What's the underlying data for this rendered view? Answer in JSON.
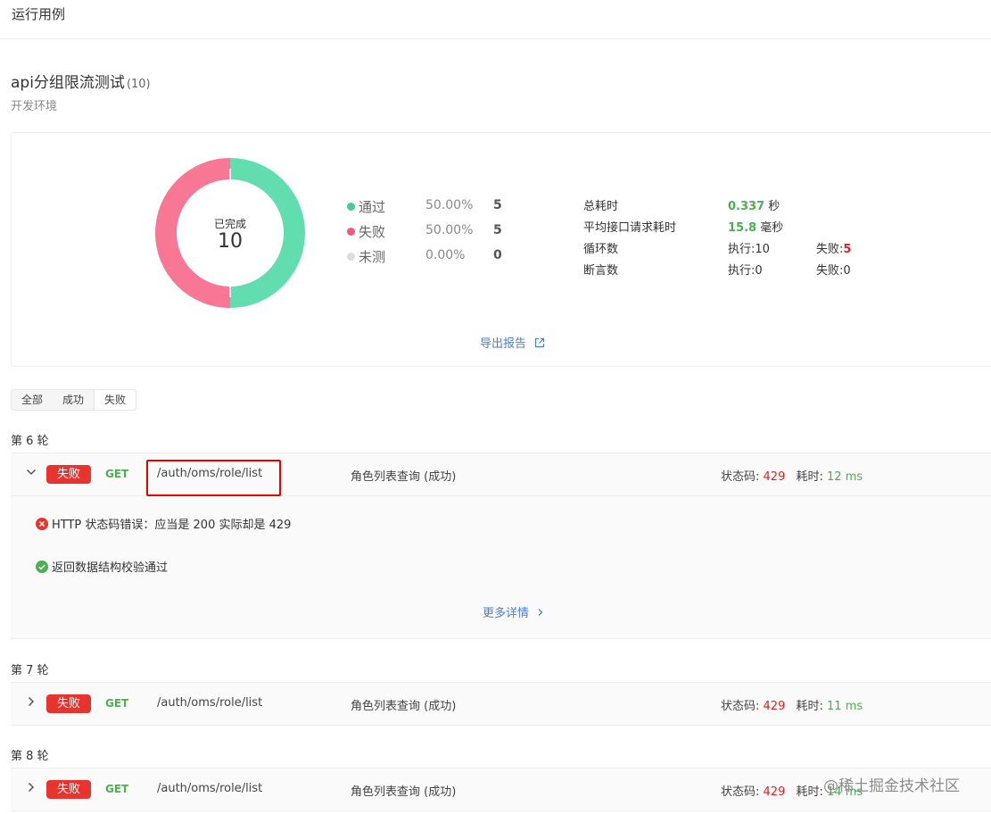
{
  "header": {
    "title": "运行用例"
  },
  "suite": {
    "name": "api分组限流测试",
    "count": "(10)",
    "env": "开发环境"
  },
  "summary": {
    "donut": {
      "label": "已完成",
      "value": "10",
      "pass_fraction": 0.5,
      "fail_fraction": 0.5,
      "pass_color": "#62ddb0",
      "fail_color": "#f87795"
    },
    "legend": [
      {
        "name": "通过",
        "pct": "50.00%",
        "count": "5",
        "color": "#3fcf8f"
      },
      {
        "name": "失败",
        "pct": "50.00%",
        "count": "5",
        "color": "#f5587f"
      },
      {
        "name": "未测",
        "pct": "0.00%",
        "count": "0",
        "color": "#dddddd"
      }
    ],
    "stats": {
      "total_time_label": "总耗时",
      "total_time_value": "0.337",
      "total_time_unit": "秒",
      "avg_time_label": "平均接口请求耗时",
      "avg_time_value": "15.8",
      "avg_time_unit": "毫秒",
      "loop_label": "循环数",
      "loop_exec": "执行:10",
      "loop_fail_label": "失败:",
      "loop_fail_value": "5",
      "assert_label": "断言数",
      "assert_exec": "执行:0",
      "assert_fail": "失败:0"
    },
    "export_label": "导出报告"
  },
  "filters": [
    {
      "label": "全部"
    },
    {
      "label": "成功"
    },
    {
      "label": "失败",
      "active": true
    }
  ],
  "rounds": [
    {
      "label": "第 6 轮",
      "expanded": true,
      "status": "失败",
      "method": "GET",
      "path": "/auth/oms/role/list",
      "case": "角色列表查询 (成功)",
      "status_code_label": "状态码:",
      "status_code": "429",
      "time_label": "耗时:",
      "time": "12 ms",
      "assertions": [
        {
          "type": "error",
          "text": "HTTP 状态码错误：应当是 200 实际却是 429"
        },
        {
          "type": "success",
          "text": "返回数据结构校验通过"
        }
      ],
      "more_label": "更多详情"
    },
    {
      "label": "第 7 轮",
      "expanded": false,
      "status": "失败",
      "method": "GET",
      "path": "/auth/oms/role/list",
      "case": "角色列表查询 (成功)",
      "status_code_label": "状态码:",
      "status_code": "429",
      "time_label": "耗时:",
      "time": "11 ms"
    },
    {
      "label": "第 8 轮",
      "expanded": false,
      "status": "失败",
      "method": "GET",
      "path": "/auth/oms/role/list",
      "case": "角色列表查询 (成功)",
      "status_code_label": "状态码:",
      "status_code": "429",
      "time_label": "耗时:",
      "time": "14 ms"
    }
  ],
  "watermark": "@稀土掘金技术社区"
}
